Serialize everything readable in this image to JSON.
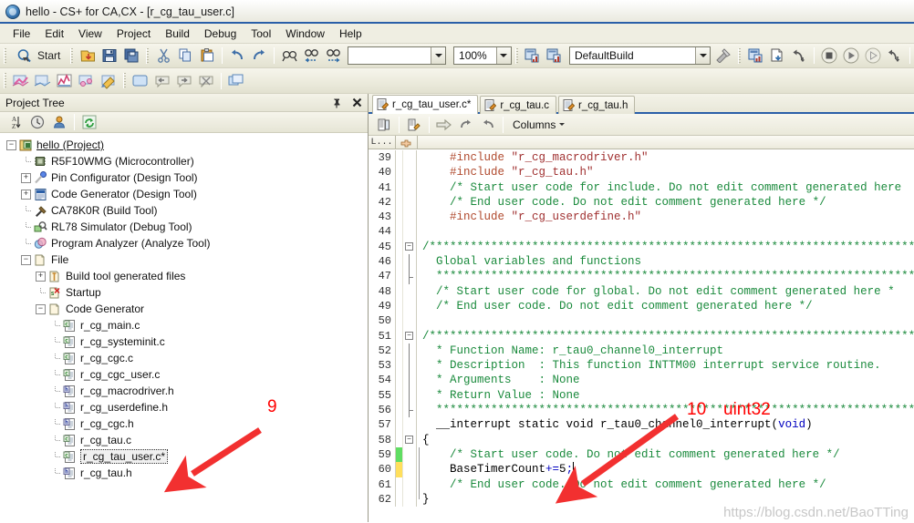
{
  "window": {
    "title": "hello - CS+ for CA,CX - [r_cg_tau_user.c]",
    "app_icon": "cs-plus-icon"
  },
  "menubar": {
    "items": [
      "File",
      "Edit",
      "View",
      "Project",
      "Build",
      "Debug",
      "Tool",
      "Window",
      "Help"
    ]
  },
  "toolbar": {
    "start_label": "Start",
    "zoom_value": "100%",
    "build_config": "DefaultBuild",
    "search_placeholder": ""
  },
  "project_tree": {
    "title": "Project Tree",
    "pin_icon": "pin-icon",
    "close_icon": "close-icon",
    "toolbar_icons": [
      "sort-icon",
      "clock-icon",
      "user-icon",
      "refresh-icon"
    ],
    "nodes": [
      {
        "label": "hello (Project)",
        "depth": 0,
        "expander": "minus",
        "icon": "project-icon",
        "underline": true
      },
      {
        "label": "R5F10WMG (Microcontroller)",
        "depth": 1,
        "expander": "none",
        "icon": "chip-icon"
      },
      {
        "label": "Pin Configurator (Design Tool)",
        "depth": 1,
        "expander": "plus",
        "icon": "pin-tool-icon"
      },
      {
        "label": "Code Generator (Design Tool)",
        "depth": 1,
        "expander": "plus",
        "icon": "codegen-icon"
      },
      {
        "label": "CA78K0R (Build Tool)",
        "depth": 1,
        "expander": "none",
        "icon": "hammer-icon"
      },
      {
        "label": "RL78 Simulator (Debug Tool)",
        "depth": 1,
        "expander": "none",
        "icon": "debug-icon"
      },
      {
        "label": "Program Analyzer (Analyze Tool)",
        "depth": 1,
        "expander": "none",
        "icon": "analyze-icon"
      },
      {
        "label": "File",
        "depth": 1,
        "expander": "minus",
        "icon": "folder-icon"
      },
      {
        "label": "Build tool generated files",
        "depth": 2,
        "expander": "plus",
        "icon": "folder-gen-icon"
      },
      {
        "label": "Startup",
        "depth": 2,
        "expander": "none",
        "icon": "startup-icon"
      },
      {
        "label": "Code Generator",
        "depth": 2,
        "expander": "minus",
        "icon": "folder-icon"
      },
      {
        "label": "r_cg_main.c",
        "depth": 3,
        "expander": "none",
        "icon": "c-file-icon"
      },
      {
        "label": "r_cg_systeminit.c",
        "depth": 3,
        "expander": "none",
        "icon": "c-file-icon"
      },
      {
        "label": "r_cg_cgc.c",
        "depth": 3,
        "expander": "none",
        "icon": "c-file-icon"
      },
      {
        "label": "r_cg_cgc_user.c",
        "depth": 3,
        "expander": "none",
        "icon": "c-file-icon"
      },
      {
        "label": "r_cg_macrodriver.h",
        "depth": 3,
        "expander": "none",
        "icon": "h-file-icon"
      },
      {
        "label": "r_cg_userdefine.h",
        "depth": 3,
        "expander": "none",
        "icon": "h-file-icon"
      },
      {
        "label": "r_cg_cgc.h",
        "depth": 3,
        "expander": "none",
        "icon": "h-file-icon"
      },
      {
        "label": "r_cg_tau.c",
        "depth": 3,
        "expander": "none",
        "icon": "c-file-icon"
      },
      {
        "label": "r_cg_tau_user.c*",
        "depth": 3,
        "expander": "none",
        "icon": "c-file-icon",
        "selected": true
      },
      {
        "label": "r_cg_tau.h",
        "depth": 3,
        "expander": "none",
        "icon": "h-file-icon"
      }
    ]
  },
  "editor": {
    "tabs": [
      {
        "label": "r_cg_tau_user.c*",
        "active": true
      },
      {
        "label": "r_cg_tau.c",
        "active": false
      },
      {
        "label": "r_cg_tau.h",
        "active": false
      }
    ],
    "toolbar": {
      "columns_label": "Columns"
    },
    "gutter_header": {
      "line_col": "L...",
      "bookmark_col": "bookmark-icon"
    },
    "lines": [
      {
        "n": 39,
        "mark": "",
        "fold": "",
        "tokens": [
          {
            "t": "    ",
            "c": ""
          },
          {
            "t": "#include ",
            "c": "pre"
          },
          {
            "t": "\"r_cg_macrodriver.h\"",
            "c": "str"
          }
        ]
      },
      {
        "n": 40,
        "mark": "",
        "fold": "",
        "tokens": [
          {
            "t": "    ",
            "c": ""
          },
          {
            "t": "#include ",
            "c": "pre"
          },
          {
            "t": "\"r_cg_tau.h\"",
            "c": "str"
          }
        ]
      },
      {
        "n": 41,
        "mark": "",
        "fold": "",
        "tokens": [
          {
            "t": "    /* Start user code for include. Do not edit comment generated here",
            "c": "com"
          }
        ]
      },
      {
        "n": 42,
        "mark": "",
        "fold": "",
        "tokens": [
          {
            "t": "    /* End user code. Do not edit comment generated here */",
            "c": "com"
          }
        ]
      },
      {
        "n": 43,
        "mark": "",
        "fold": "",
        "tokens": [
          {
            "t": "    ",
            "c": ""
          },
          {
            "t": "#include ",
            "c": "pre"
          },
          {
            "t": "\"r_cg_userdefine.h\"",
            "c": "str"
          }
        ]
      },
      {
        "n": 44,
        "mark": "",
        "fold": "",
        "tokens": [
          {
            "t": "",
            "c": ""
          }
        ]
      },
      {
        "n": 45,
        "mark": "",
        "fold": "start",
        "tokens": [
          {
            "t": "/***********************************************************************************",
            "c": "com"
          }
        ]
      },
      {
        "n": 46,
        "mark": "",
        "fold": "mid",
        "tokens": [
          {
            "t": "  Global variables and functions",
            "c": "com"
          }
        ]
      },
      {
        "n": 47,
        "mark": "",
        "fold": "end",
        "tokens": [
          {
            "t": "  *********************************************************************************",
            "c": "com"
          }
        ]
      },
      {
        "n": 48,
        "mark": "",
        "fold": "",
        "tokens": [
          {
            "t": "  /* Start user code for global. Do not edit comment generated here *",
            "c": "com"
          }
        ]
      },
      {
        "n": 49,
        "mark": "",
        "fold": "",
        "tokens": [
          {
            "t": "  /* End user code. Do not edit comment generated here */",
            "c": "com"
          }
        ]
      },
      {
        "n": 50,
        "mark": "",
        "fold": "",
        "tokens": [
          {
            "t": "",
            "c": ""
          }
        ]
      },
      {
        "n": 51,
        "mark": "",
        "fold": "start",
        "tokens": [
          {
            "t": "/***********************************************************************************",
            "c": "com"
          }
        ]
      },
      {
        "n": 52,
        "mark": "",
        "fold": "mid",
        "tokens": [
          {
            "t": "  * Function Name: r_tau0_channel0_interrupt",
            "c": "com"
          }
        ]
      },
      {
        "n": 53,
        "mark": "",
        "fold": "mid",
        "tokens": [
          {
            "t": "  * Description  : This function INTTM00 interrupt service routine.",
            "c": "com"
          }
        ]
      },
      {
        "n": 54,
        "mark": "",
        "fold": "mid",
        "tokens": [
          {
            "t": "  * Arguments    : None",
            "c": "com"
          }
        ]
      },
      {
        "n": 55,
        "mark": "",
        "fold": "mid",
        "tokens": [
          {
            "t": "  * Return Value : None",
            "c": "com"
          }
        ]
      },
      {
        "n": 56,
        "mark": "",
        "fold": "end",
        "tokens": [
          {
            "t": "  ********************************************************************************",
            "c": "com"
          }
        ]
      },
      {
        "n": 57,
        "mark": "",
        "fold": "",
        "tokens": [
          {
            "t": "  __interrupt static void r_tau0_channel0_interrupt(",
            "c": "id"
          },
          {
            "t": "void",
            "c": "kw"
          },
          {
            "t": ")",
            "c": "id"
          }
        ]
      },
      {
        "n": 58,
        "mark": "",
        "fold": "start",
        "tokens": [
          {
            "t": "{",
            "c": "id"
          }
        ]
      },
      {
        "n": 59,
        "mark": "green",
        "fold": "body",
        "tokens": [
          {
            "t": "    /* Start user code. Do not edit comment generated here */",
            "c": "com"
          }
        ]
      },
      {
        "n": 60,
        "mark": "yellow",
        "fold": "body",
        "tokens": [
          {
            "t": "    BaseTimerCount",
            "c": "id"
          },
          {
            "t": "+=",
            "c": "op"
          },
          {
            "t": "5",
            "c": "id"
          },
          {
            "t": ";",
            "c": "op"
          },
          {
            "t": "",
            "c": "caret"
          }
        ]
      },
      {
        "n": 61,
        "mark": "",
        "fold": "body",
        "tokens": [
          {
            "t": "    /* End user code. Do not edit comment generated here */",
            "c": "com"
          }
        ]
      },
      {
        "n": 62,
        "mark": "",
        "fold": "bodyend",
        "tokens": [
          {
            "t": "}",
            "c": "id"
          }
        ]
      }
    ]
  },
  "annotations": {
    "marker_9": "9",
    "marker_10": "10",
    "marker_uint32": "uint32",
    "watermark": "https://blog.csdn.net/BaoTTing",
    "arrow_color": "#f23030"
  }
}
